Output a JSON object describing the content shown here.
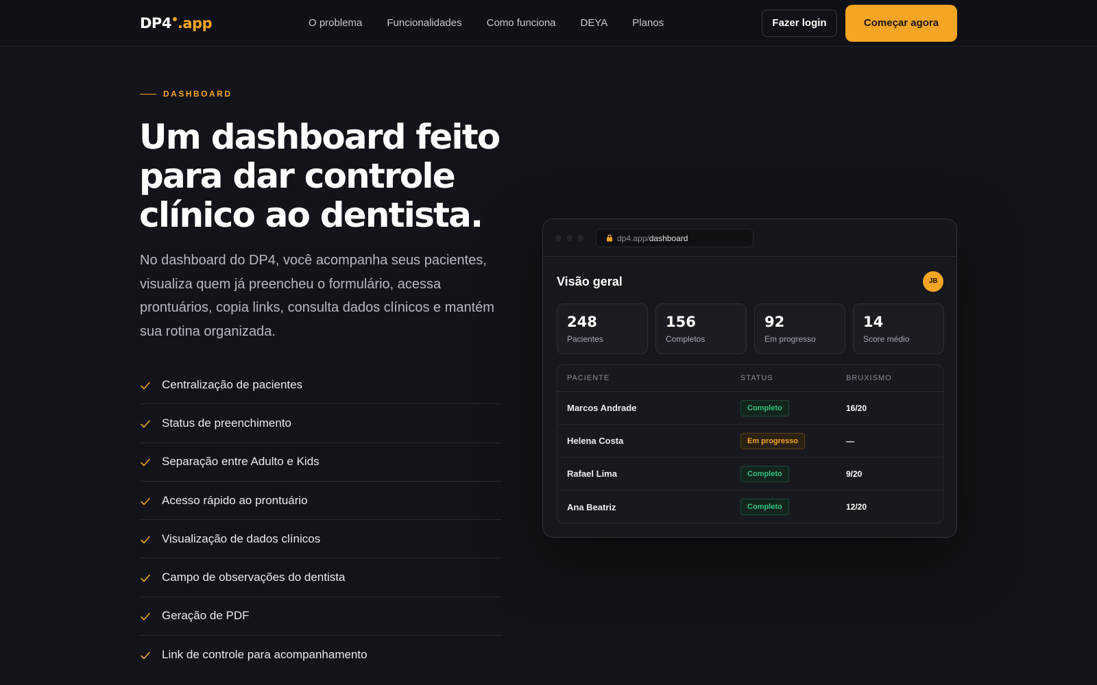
{
  "nav": {
    "logo": {
      "main": "DP4",
      "suffix": ".app"
    },
    "links": [
      "O problema",
      "Funcionalidades",
      "Como funciona",
      "DEYA",
      "Planos"
    ],
    "login_label": "Fazer login",
    "start_label": "Começar agora"
  },
  "hero": {
    "eyebrow": "DASHBOARD",
    "title": "Um dashboard feito para dar controle clínico ao dentista.",
    "description": "No dashboard do DP4, você acompanha seus pacientes, visualiza quem já preencheu o formulário, acessa prontuários, copia links, consulta dados clínicos e mantém sua rotina organizada.",
    "features": [
      "Centralização de pacientes",
      "Status de preenchimento",
      "Separação entre Adulto e Kids",
      "Acesso rápido ao prontuário",
      "Visualização de dados clínicos",
      "Campo de observações do dentista",
      "Geração de PDF",
      "Link de controle para acompanhamento"
    ]
  },
  "dashboard": {
    "url_host": "dp4.app/",
    "url_path": "dashboard",
    "title": "Visão geral",
    "avatar_initials": "JB",
    "stats": [
      {
        "value": "248",
        "label": "Pacientes"
      },
      {
        "value": "156",
        "label": "Completos"
      },
      {
        "value": "92",
        "label": "Em progresso"
      },
      {
        "value": "14",
        "label": "Score médio"
      }
    ],
    "table": {
      "headers": [
        "PACIENTE",
        "STATUS",
        "BRUXISMO"
      ],
      "rows": [
        {
          "name": "Marcos Andrade",
          "status": "Completo",
          "score": "16/20"
        },
        {
          "name": "Helena Costa",
          "status": "Em progresso",
          "score": "—"
        },
        {
          "name": "Rafael Lima",
          "status": "Completo",
          "score": "9/20"
        },
        {
          "name": "Ana Beatriz",
          "status": "Completo",
          "score": "12/20"
        }
      ]
    }
  },
  "colors": {
    "accent": "#f5a524",
    "success": "#2ec27e",
    "background": "#131419"
  }
}
